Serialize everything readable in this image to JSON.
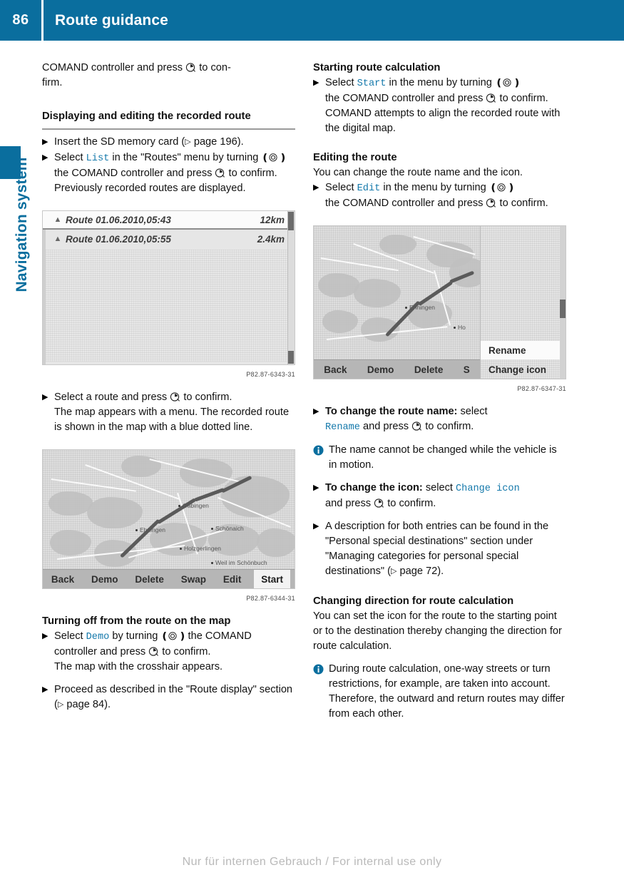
{
  "header": {
    "page_number": "86",
    "title": "Route guidance"
  },
  "sidebar": {
    "chapter_label": "Navigation system",
    "accent_color": "#0a6e9e"
  },
  "left_column": {
    "intro": {
      "line1_a": "COMAND controller and press",
      "line1_b": "to con-",
      "line2": "firm."
    },
    "heading_displaying": "Displaying and editing the recorded route",
    "step_insert": {
      "text_a": "Insert the SD memory card (",
      "page_ref": "page 196",
      "text_b": ")."
    },
    "step_select_list": {
      "text_a": "Select",
      "code": "List",
      "text_b": "in the \"Routes\" menu by turning",
      "text_c": "the COMAND controller and press",
      "text_d": "to confirm.",
      "result": "Previously recorded routes are displayed."
    },
    "figure_routes": {
      "rows": [
        {
          "icon": "flag-icon",
          "name": "Route 01.06.2010,05:43",
          "distance": "12km",
          "selected": true
        },
        {
          "icon": "pin-icon",
          "name": "Route 01.06.2010,05:55",
          "distance": "2.4km",
          "selected": false
        }
      ],
      "caption": "P82.87-6343-31"
    },
    "step_select_route": {
      "text_a": "Select a route and press",
      "text_b": "to confirm.",
      "result": "The map appears with a menu. The recorded route is shown in the map with a blue dotted line."
    },
    "figure_map": {
      "menu_items": [
        "Back",
        "Demo",
        "Delete",
        "Swap",
        "Edit",
        "Start"
      ],
      "highlighted_item": "Start",
      "places": [
        "Gäbingen",
        "Schönaich",
        "Holzgerlingen",
        "Weil im Schönbuch",
        "Ehningen"
      ],
      "caption": "P82.87-6344-31"
    },
    "heading_turning_off": "Turning off from the route on the map",
    "step_demo": {
      "text_a": "Select",
      "code": "Demo",
      "text_b": "by turning",
      "text_c": "the COMAND controller and press",
      "text_d": "to confirm.",
      "result": "The map with the crosshair appears."
    },
    "step_proceed": {
      "text_a": "Proceed as described in the \"Route display\" section (",
      "page_ref": "page 84",
      "text_b": ")."
    }
  },
  "right_column": {
    "heading_starting": "Starting route calculation",
    "step_start": {
      "text_a": "Select",
      "code": "Start",
      "text_b": "in the menu by turning",
      "text_c": "the COMAND controller and press",
      "text_d": "to confirm.",
      "result": "COMAND attempts to align the recorded route with the digital map."
    },
    "heading_editing": "Editing the route",
    "editing_intro": "You can change the route name and the icon.",
    "step_edit": {
      "text_a": "Select",
      "code": "Edit",
      "text_b": "in the menu by turning",
      "text_c": "the COMAND controller and press",
      "text_d": "to confirm."
    },
    "figure_edit": {
      "menu_items": [
        "Back",
        "Demo",
        "Delete",
        "S"
      ],
      "popup_items": [
        "Rename",
        "Change icon"
      ],
      "highlighted_popup_item": "Rename",
      "caption": "P82.87-6347-31"
    },
    "step_rename": {
      "bold": "To change the route name:",
      "text_a": "select",
      "code": "Rename",
      "text_b": "and press",
      "text_c": "to confirm."
    },
    "note_name": "The name cannot be changed while the vehicle is in motion.",
    "step_change_icon": {
      "bold": "To change the icon:",
      "text_a": "select",
      "code": "Change icon",
      "text_b": "and press",
      "text_c": "to confirm."
    },
    "step_description": {
      "text_a": "A description for both entries can be found in the \"Personal special destinations\" section under \"Managing categories for personal special destinations\" (",
      "page_ref": "page 72",
      "text_b": ")."
    },
    "heading_changing_direction": "Changing direction for route calculation",
    "changing_direction_intro": "You can set the icon for the route to the starting point or to the destination thereby changing the direction for route calculation.",
    "note_oneway": "During route calculation, one-way streets or turn restrictions, for example, are taken into account. Therefore, the outward and return routes may differ from each other."
  },
  "footer": {
    "text": "Nur für internen Gebrauch / For internal use only"
  }
}
